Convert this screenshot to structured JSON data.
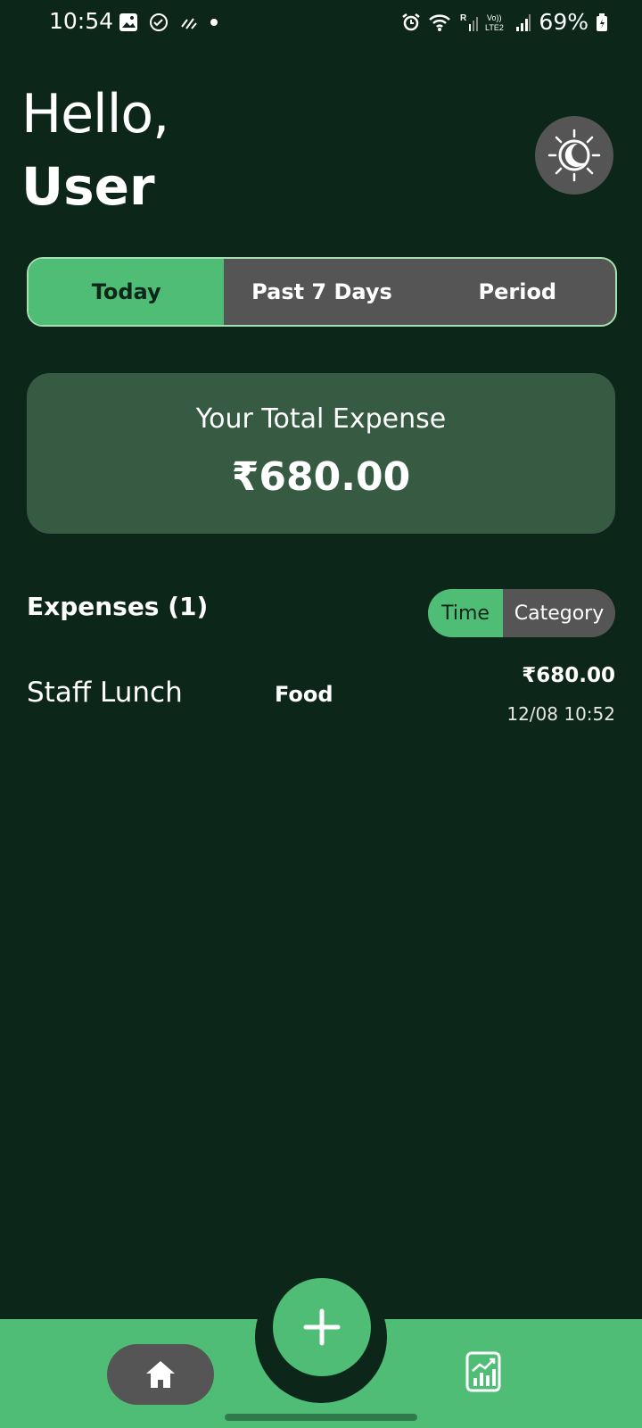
{
  "status_bar": {
    "time": "10:54",
    "battery": "69%"
  },
  "greeting": {
    "hello": "Hello,",
    "user": "User"
  },
  "period_tabs": [
    {
      "label": "Today",
      "active": true
    },
    {
      "label": "Past 7 Days",
      "active": false
    },
    {
      "label": "Period",
      "active": false
    }
  ],
  "summary": {
    "title": "Your Total Expense",
    "amount": "₹680.00"
  },
  "expenses": {
    "header": "Expenses (1)",
    "sort_options": [
      "Time",
      "Category"
    ],
    "sort_selected": "Time",
    "items": [
      {
        "name": "Staff Lunch",
        "category": "Food",
        "amount": "₹680.00",
        "datetime": "12/08 10:52"
      }
    ]
  },
  "colors": {
    "background": "#0c261a",
    "accent": "#4fbd75",
    "card": "#375a43",
    "inactive": "#555555"
  },
  "icons": {
    "theme": "theme-toggle-icon",
    "add": "plus-icon",
    "home": "home-icon",
    "stats": "stats-chart-icon"
  }
}
